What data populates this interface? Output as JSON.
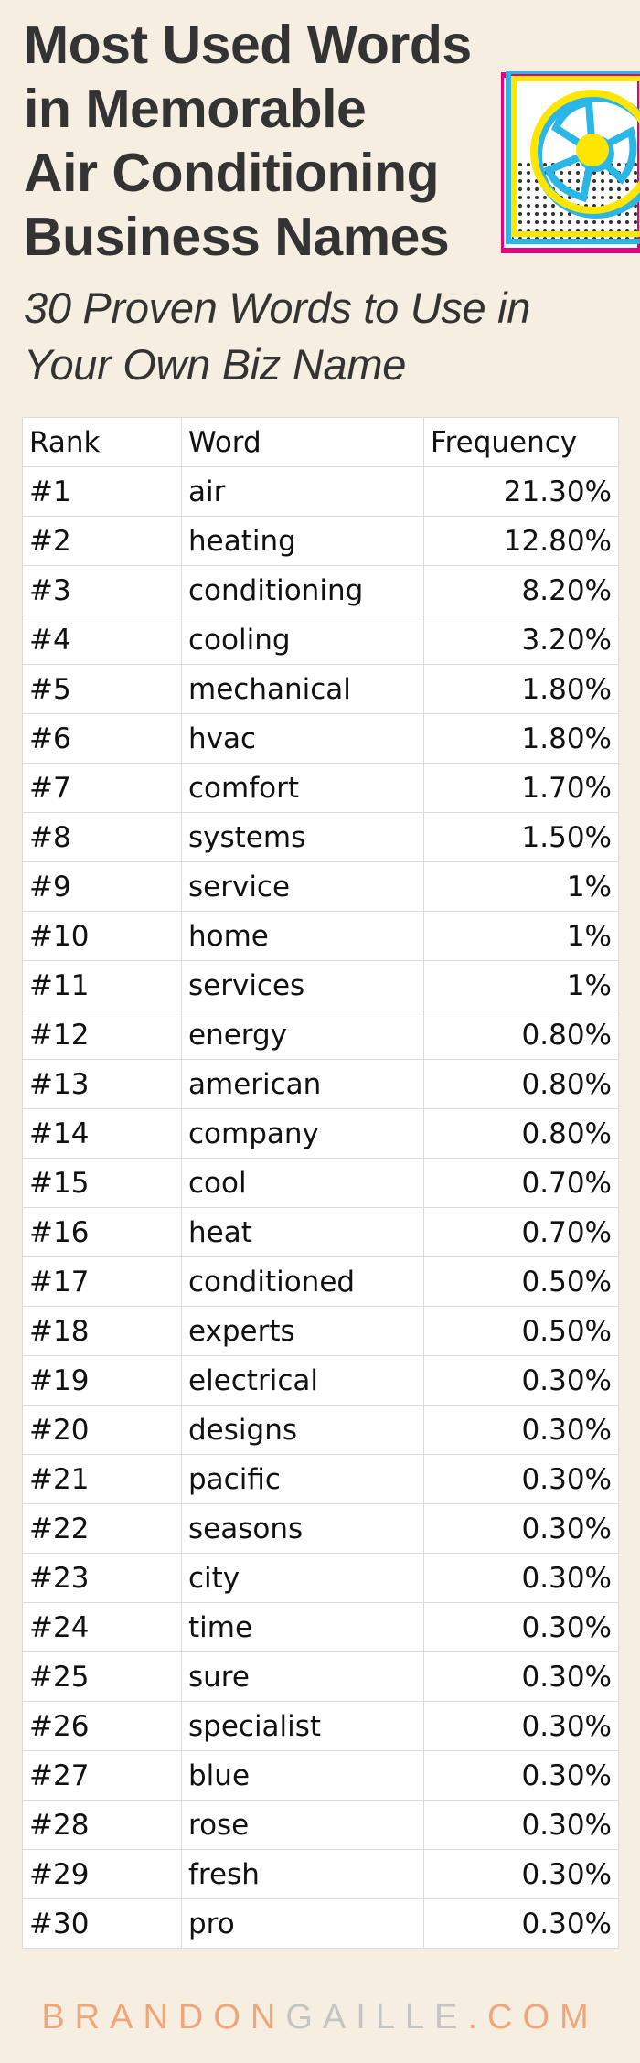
{
  "header": {
    "title_lines": [
      "Most Used Words",
      "in Memorable",
      "Air Conditioning",
      "Business Names"
    ],
    "subtitle_lines": [
      "30 Proven Words to Use in",
      "Your Own Biz Name"
    ]
  },
  "graphic": {
    "icon": "air-conditioner-fan-icon",
    "colors": {
      "yellow": "#ffe600",
      "cyan": "#2ab7e8",
      "magenta": "#e6007e",
      "dots": "#333333"
    }
  },
  "table": {
    "headers": [
      "Rank",
      "Word",
      "Frequency"
    ],
    "rows": [
      [
        "#1",
        "air",
        "21.30%"
      ],
      [
        "#2",
        "heating",
        "12.80%"
      ],
      [
        "#3",
        "conditioning",
        "8.20%"
      ],
      [
        "#4",
        "cooling",
        "3.20%"
      ],
      [
        "#5",
        "mechanical",
        "1.80%"
      ],
      [
        "#6",
        "hvac",
        "1.80%"
      ],
      [
        "#7",
        "comfort",
        "1.70%"
      ],
      [
        "#8",
        "systems",
        "1.50%"
      ],
      [
        "#9",
        "service",
        "1%"
      ],
      [
        "#10",
        "home",
        "1%"
      ],
      [
        "#11",
        "services",
        "1%"
      ],
      [
        "#12",
        "energy",
        "0.80%"
      ],
      [
        "#13",
        "american",
        "0.80%"
      ],
      [
        "#14",
        "company",
        "0.80%"
      ],
      [
        "#15",
        "cool",
        "0.70%"
      ],
      [
        "#16",
        "heat",
        "0.70%"
      ],
      [
        "#17",
        "conditioned",
        "0.50%"
      ],
      [
        "#18",
        "experts",
        "0.50%"
      ],
      [
        "#19",
        "electrical",
        "0.30%"
      ],
      [
        "#20",
        "designs",
        "0.30%"
      ],
      [
        "#21",
        "pacific",
        "0.30%"
      ],
      [
        "#22",
        "seasons",
        "0.30%"
      ],
      [
        "#23",
        "city",
        "0.30%"
      ],
      [
        "#24",
        "time",
        "0.30%"
      ],
      [
        "#25",
        "sure",
        "0.30%"
      ],
      [
        "#26",
        "specialist",
        "0.30%"
      ],
      [
        "#27",
        "blue",
        "0.30%"
      ],
      [
        "#28",
        "rose",
        "0.30%"
      ],
      [
        "#29",
        "fresh",
        "0.30%"
      ],
      [
        "#30",
        "pro",
        "0.30%"
      ]
    ]
  },
  "footer": {
    "brand_part1": "BRANDON",
    "brand_part2": "GAILLE",
    "brand_part3": ".COM"
  },
  "colors": {
    "background": "#f6eee0",
    "title_text": "#333333",
    "footer_accent": "#f0a679",
    "footer_gray": "#c4c4c4"
  }
}
